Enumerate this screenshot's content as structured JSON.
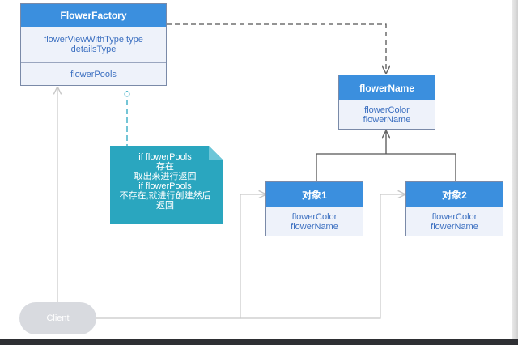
{
  "factory": {
    "title": "FlowerFactory",
    "attributes": [
      "flowerViewWithType:type",
      "detailsType"
    ],
    "operation": "flowerPools"
  },
  "flower_name": {
    "title": "flowerName",
    "fields": [
      "flowerColor",
      "flowerName"
    ]
  },
  "object1": {
    "title": "对象1",
    "fields": [
      "flowerColor",
      "flowerName"
    ]
  },
  "object2": {
    "title": "对象2",
    "fields": [
      "flowerColor",
      "flowerName"
    ]
  },
  "note": {
    "lines": [
      "if flowerPools",
      "存在",
      "取出来进行返回",
      "if  flowerPools",
      "不存在,就进行创建然后",
      "返回"
    ]
  },
  "client": {
    "label": "Client"
  },
  "colors": {
    "header_blue": "#3b8fde",
    "box_fill": "#eef2fa",
    "note_teal": "#2aa6bf",
    "client_gray": "#d8dadf"
  }
}
